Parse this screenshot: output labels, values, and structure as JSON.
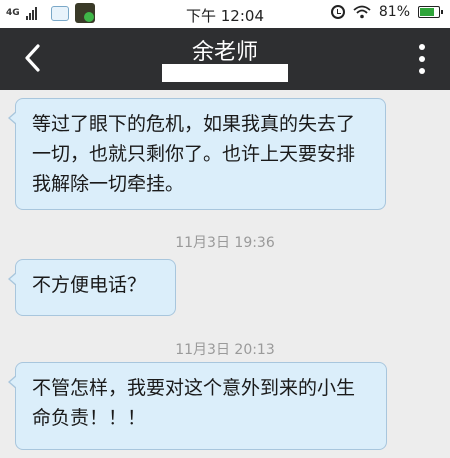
{
  "status_bar": {
    "network": "4G",
    "time": "下午 12:04",
    "battery": "81%"
  },
  "header": {
    "title": "余老师"
  },
  "messages": [
    {
      "text": "等过了眼下的危机，如果我真的失去了一切，也就只剩你了。也许上天要安排我解除一切牵挂。"
    },
    {
      "timestamp": "11月3日 19:36",
      "text": "不方便电话？"
    },
    {
      "timestamp": "11月3日 20:13",
      "text": "不管怎样，我要对这个意外到来的小生命负责！！！"
    }
  ],
  "colors": {
    "title_bar_bg": "#2e2f31",
    "bubble_bg": "#dbeefa",
    "chat_bg": "#ededed"
  }
}
